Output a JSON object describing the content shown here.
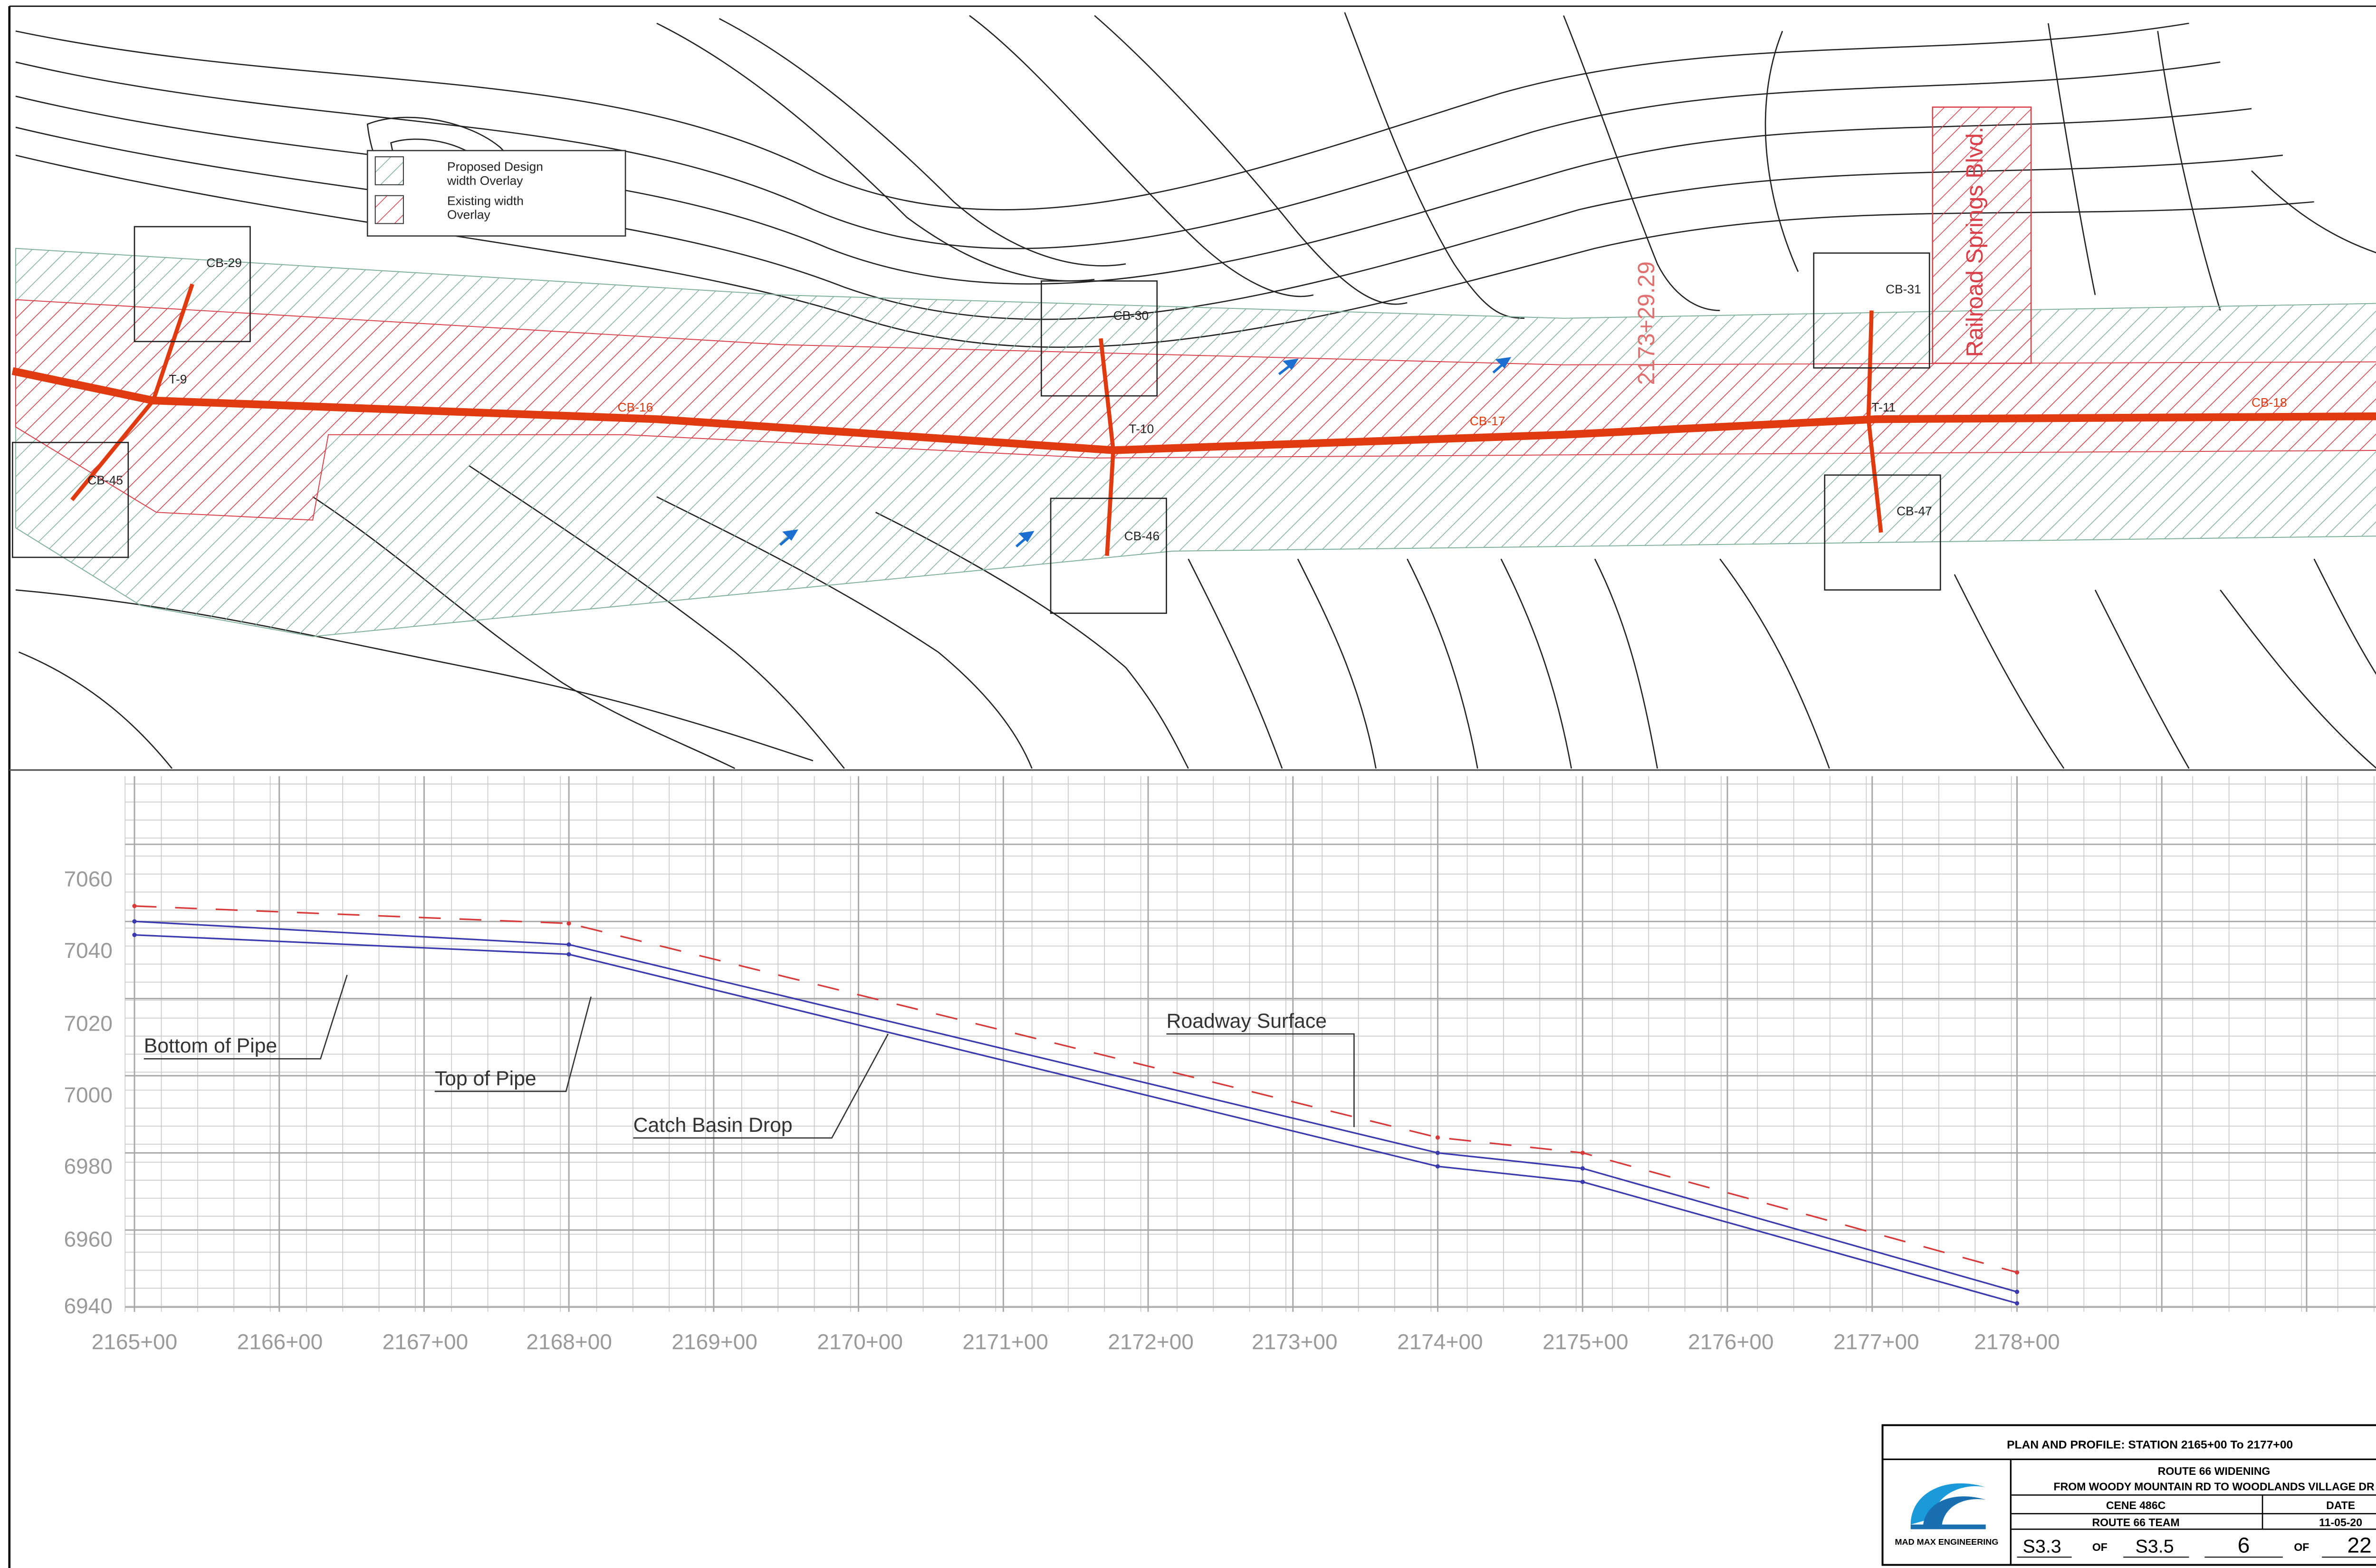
{
  "plan": {
    "legend": {
      "proposed": [
        "Proposed Design",
        "width Overlay"
      ],
      "existing": [
        "Existing width",
        "Overlay"
      ]
    },
    "street_label": "Railroad Springs Blvd.",
    "structures": [
      "CB-29",
      "CB-30",
      "CB-31",
      "CB-45",
      "CB-46",
      "CB-47"
    ],
    "junctions": [
      "T-9",
      "T-10",
      "T-11"
    ],
    "pipe_labels": [
      "CB-16",
      "CB-17",
      "CB-18"
    ],
    "station_labels": [
      "2173+29.29"
    ],
    "colors": {
      "pipe": "#e03a10",
      "existing": "#d9404a",
      "proposed": "#7fb09a",
      "contour": "#222222",
      "flow_arrow": "#1a6fd0"
    }
  },
  "profile": {
    "y_ticks": [
      "7060",
      "7040",
      "7020",
      "7000",
      "6980",
      "6960",
      "6940"
    ],
    "x_ticks": [
      "2165+00",
      "2166+00",
      "2167+00",
      "2168+00",
      "2169+00",
      "2170+00",
      "2171+00",
      "2172+00",
      "2173+00",
      "2174+00",
      "2175+00",
      "2176+00",
      "2177+00",
      "2178+00"
    ],
    "callouts": {
      "bottom_of_pipe": "Bottom of Pipe",
      "top_of_pipe": "Top of Pipe",
      "catch_basin_drop": "Catch Basin Drop",
      "roadway_surface": "Roadway Surface"
    },
    "x_range": [
      2165,
      2178
    ],
    "y_range": [
      6940,
      7070
    ],
    "series": {
      "roadway_surface": [
        [
          2165,
          7044
        ],
        [
          2168,
          7039.5
        ],
        [
          2174,
          6984
        ],
        [
          2175,
          6980
        ],
        [
          2178,
          6949
        ]
      ],
      "top_of_pipe": [
        [
          2165,
          7040
        ],
        [
          2168,
          7034
        ],
        [
          2174,
          6980
        ],
        [
          2175,
          6976
        ],
        [
          2178,
          6944
        ]
      ],
      "bottom_of_pipe": [
        [
          2165,
          7036.5
        ],
        [
          2168,
          7031.5
        ],
        [
          2174,
          6976.5
        ],
        [
          2175,
          6972.5
        ],
        [
          2178,
          6941
        ]
      ]
    },
    "colors": {
      "roadway": "#d83a3a",
      "pipe": "#3a3ab0",
      "grid": "#c8c8c8"
    }
  },
  "title_block": {
    "plan_title": "PLAN AND PROFILE: STATION 2165+00 To 2177+00",
    "project": "ROUTE 66 WIDENING",
    "limits": "FROM WOODY MOUNTAIN RD TO WOODLANDS VILLAGE DR",
    "course": "CENE 486C",
    "team": "ROUTE 66 TEAM",
    "date_label": "DATE",
    "date": "11-05-20",
    "company": "MAD MAX ENGINEERING",
    "sheet_no": "S3.3",
    "of_label": "OF",
    "sheet_total": "S3.5",
    "page_no": "6",
    "page_total": "22"
  }
}
